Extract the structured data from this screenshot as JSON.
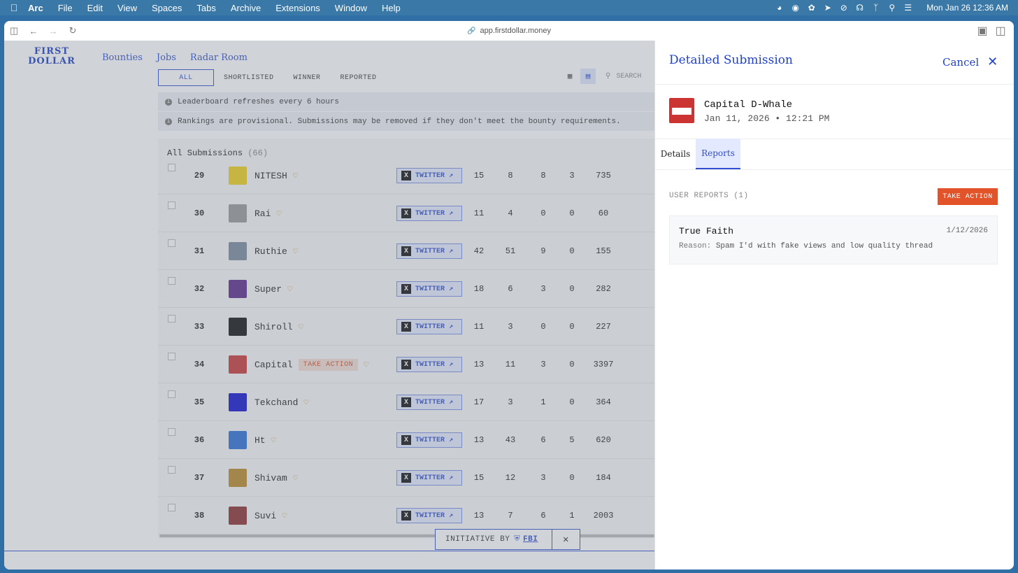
{
  "menubar": {
    "app": "Arc",
    "items": [
      "File",
      "Edit",
      "View",
      "Spaces",
      "Tabs",
      "Archive",
      "Extensions",
      "Window",
      "Help"
    ],
    "clock": "Mon Jan 26  12:36 AM"
  },
  "browser": {
    "url": "app.firstdollar.money"
  },
  "site": {
    "logo": "FIRST DOLLAR",
    "nav": [
      "Bounties",
      "Jobs",
      "Radar Room"
    ]
  },
  "filters": {
    "tabs": [
      "ALL",
      "SHORTLISTED",
      "WINNER",
      "REPORTED"
    ],
    "search_placeholder": "SEARCH"
  },
  "banners": {
    "refresh": "Leaderboard refreshes every 6 hours",
    "provisional": "Rankings are provisional. Submissions may be removed if they don't meet the bounty requirements."
  },
  "table": {
    "title": "All Submissions",
    "count": "(66)",
    "platform_label": "TWITTER",
    "take_action_label": "TAKE ACTION",
    "rows": [
      {
        "rank": "29",
        "name": "NITESH",
        "c1": "15",
        "c2": "8",
        "c3": "8",
        "c4": "3",
        "c5": "735",
        "avatar_color": "#f2d21c"
      },
      {
        "rank": "30",
        "name": "Rai",
        "c1": "11",
        "c2": "4",
        "c3": "0",
        "c4": "0",
        "c5": "60",
        "avatar_color": "#999999"
      },
      {
        "rank": "31",
        "name": "Ruthie",
        "c1": "42",
        "c2": "51",
        "c3": "9",
        "c4": "0",
        "c5": "155",
        "avatar_color": "#7a8aa0"
      },
      {
        "rank": "32",
        "name": "Super",
        "c1": "18",
        "c2": "6",
        "c3": "3",
        "c4": "0",
        "c5": "282",
        "avatar_color": "#5b2a8a"
      },
      {
        "rank": "33",
        "name": "Shiroll",
        "c1": "11",
        "c2": "3",
        "c3": "0",
        "c4": "0",
        "c5": "227",
        "avatar_color": "#111111"
      },
      {
        "rank": "34",
        "name": "Capital",
        "c1": "13",
        "c2": "11",
        "c3": "3",
        "c4": "0",
        "c5": "3397",
        "avatar_color": "#c83a3a",
        "take_action": true
      },
      {
        "rank": "35",
        "name": "Tekchand",
        "c1": "17",
        "c2": "3",
        "c3": "1",
        "c4": "0",
        "c5": "364",
        "avatar_color": "#1010d0"
      },
      {
        "rank": "36",
        "name": "Ht",
        "c1": "13",
        "c2": "43",
        "c3": "6",
        "c4": "5",
        "c5": "620",
        "avatar_color": "#2d6fd8"
      },
      {
        "rank": "37",
        "name": "Shivam",
        "c1": "15",
        "c2": "12",
        "c3": "3",
        "c4": "0",
        "c5": "184",
        "avatar_color": "#b8892a"
      },
      {
        "rank": "38",
        "name": "Suvi",
        "c1": "13",
        "c2": "7",
        "c3": "6",
        "c4": "1",
        "c5": "2003",
        "avatar_color": "#8a3030"
      }
    ]
  },
  "footer": {
    "initiative_label": "INITIATIVE BY",
    "initiative_org": "FBI"
  },
  "panel": {
    "title": "Detailed Submission",
    "cancel": "Cancel",
    "user_name": "Capital D-Whale",
    "date": "Jan 11, 2026 • 12:21 PM",
    "tabs": [
      "Details",
      "Reports"
    ],
    "reports_heading": "USER REPORTS (1)",
    "take_action": "TAKE ACTION",
    "report": {
      "author": "True Faith",
      "date": "1/12/2026",
      "reason_label": "Reason:",
      "reason": "Spam I'd with fake views and low quality thread"
    }
  }
}
